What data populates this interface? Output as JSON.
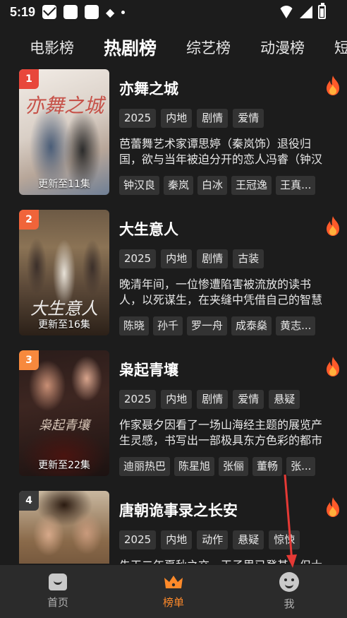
{
  "status_bar": {
    "time": "5:19"
  },
  "tabs": [
    {
      "label": "电影榜",
      "active": false
    },
    {
      "label": "热剧榜",
      "active": true
    },
    {
      "label": "综艺榜",
      "active": false
    },
    {
      "label": "动漫榜",
      "active": false
    },
    {
      "label": "短",
      "active": false
    }
  ],
  "shows": [
    {
      "rank": "1",
      "poster_text": "亦舞之城",
      "update": "更新至11集",
      "title": "亦舞之城",
      "tags": [
        "2025",
        "内地",
        "剧情",
        "爱情"
      ],
      "description": "芭蕾舞艺术家谭思婷（秦岚饰）退役归国，欲与当年被迫分开的恋人冯睿（钟汉良饰）",
      "cast": [
        "钟汉良",
        "秦岚",
        "白冰",
        "王冠逸",
        "王真..."
      ]
    },
    {
      "rank": "2",
      "poster_text": "大生意人",
      "update": "更新至16集",
      "title": "大生意人",
      "tags": [
        "2025",
        "内地",
        "剧情",
        "古装"
      ],
      "description": "晚清年间，一位惨遭陷害被流放的读书人，以死谋生，在夹缝中凭借自己的智慧",
      "cast": [
        "陈晓",
        "孙千",
        "罗一舟",
        "成泰燊",
        "黄志..."
      ]
    },
    {
      "rank": "3",
      "poster_text": "枭起青壤",
      "update": "更新至22集",
      "title": "枭起青壤",
      "tags": [
        "2025",
        "内地",
        "剧情",
        "爱情",
        "悬疑"
      ],
      "description": "作家聂夕因看了一场山海经主题的展览产生灵感，书写出一部极具东方色彩的都市",
      "cast": [
        "迪丽热巴",
        "陈星旭",
        "张俪",
        "董畅",
        "张..."
      ]
    },
    {
      "rank": "4",
      "poster_text": "",
      "update": "",
      "title": "唐朝诡事录之长安",
      "tags": [
        "2025",
        "内地",
        "动作",
        "悬疑",
        "惊悚"
      ],
      "description": "先天二年夏秋之交，王子思已登基，但大",
      "cast": []
    }
  ],
  "bottom_nav": [
    {
      "label": "首页",
      "icon": "home-icon",
      "active": false
    },
    {
      "label": "榜单",
      "icon": "crown-icon",
      "active": true
    },
    {
      "label": "我",
      "icon": "smile-icon",
      "active": false
    }
  ],
  "colors": {
    "background": "#1c1c1c",
    "accent": "#ff8a2a",
    "tag_bg": "#333333",
    "rank1": "#e8473b",
    "rank2": "#f0643a",
    "rank3": "#f7893d",
    "rank4": "#3a3a3a"
  }
}
